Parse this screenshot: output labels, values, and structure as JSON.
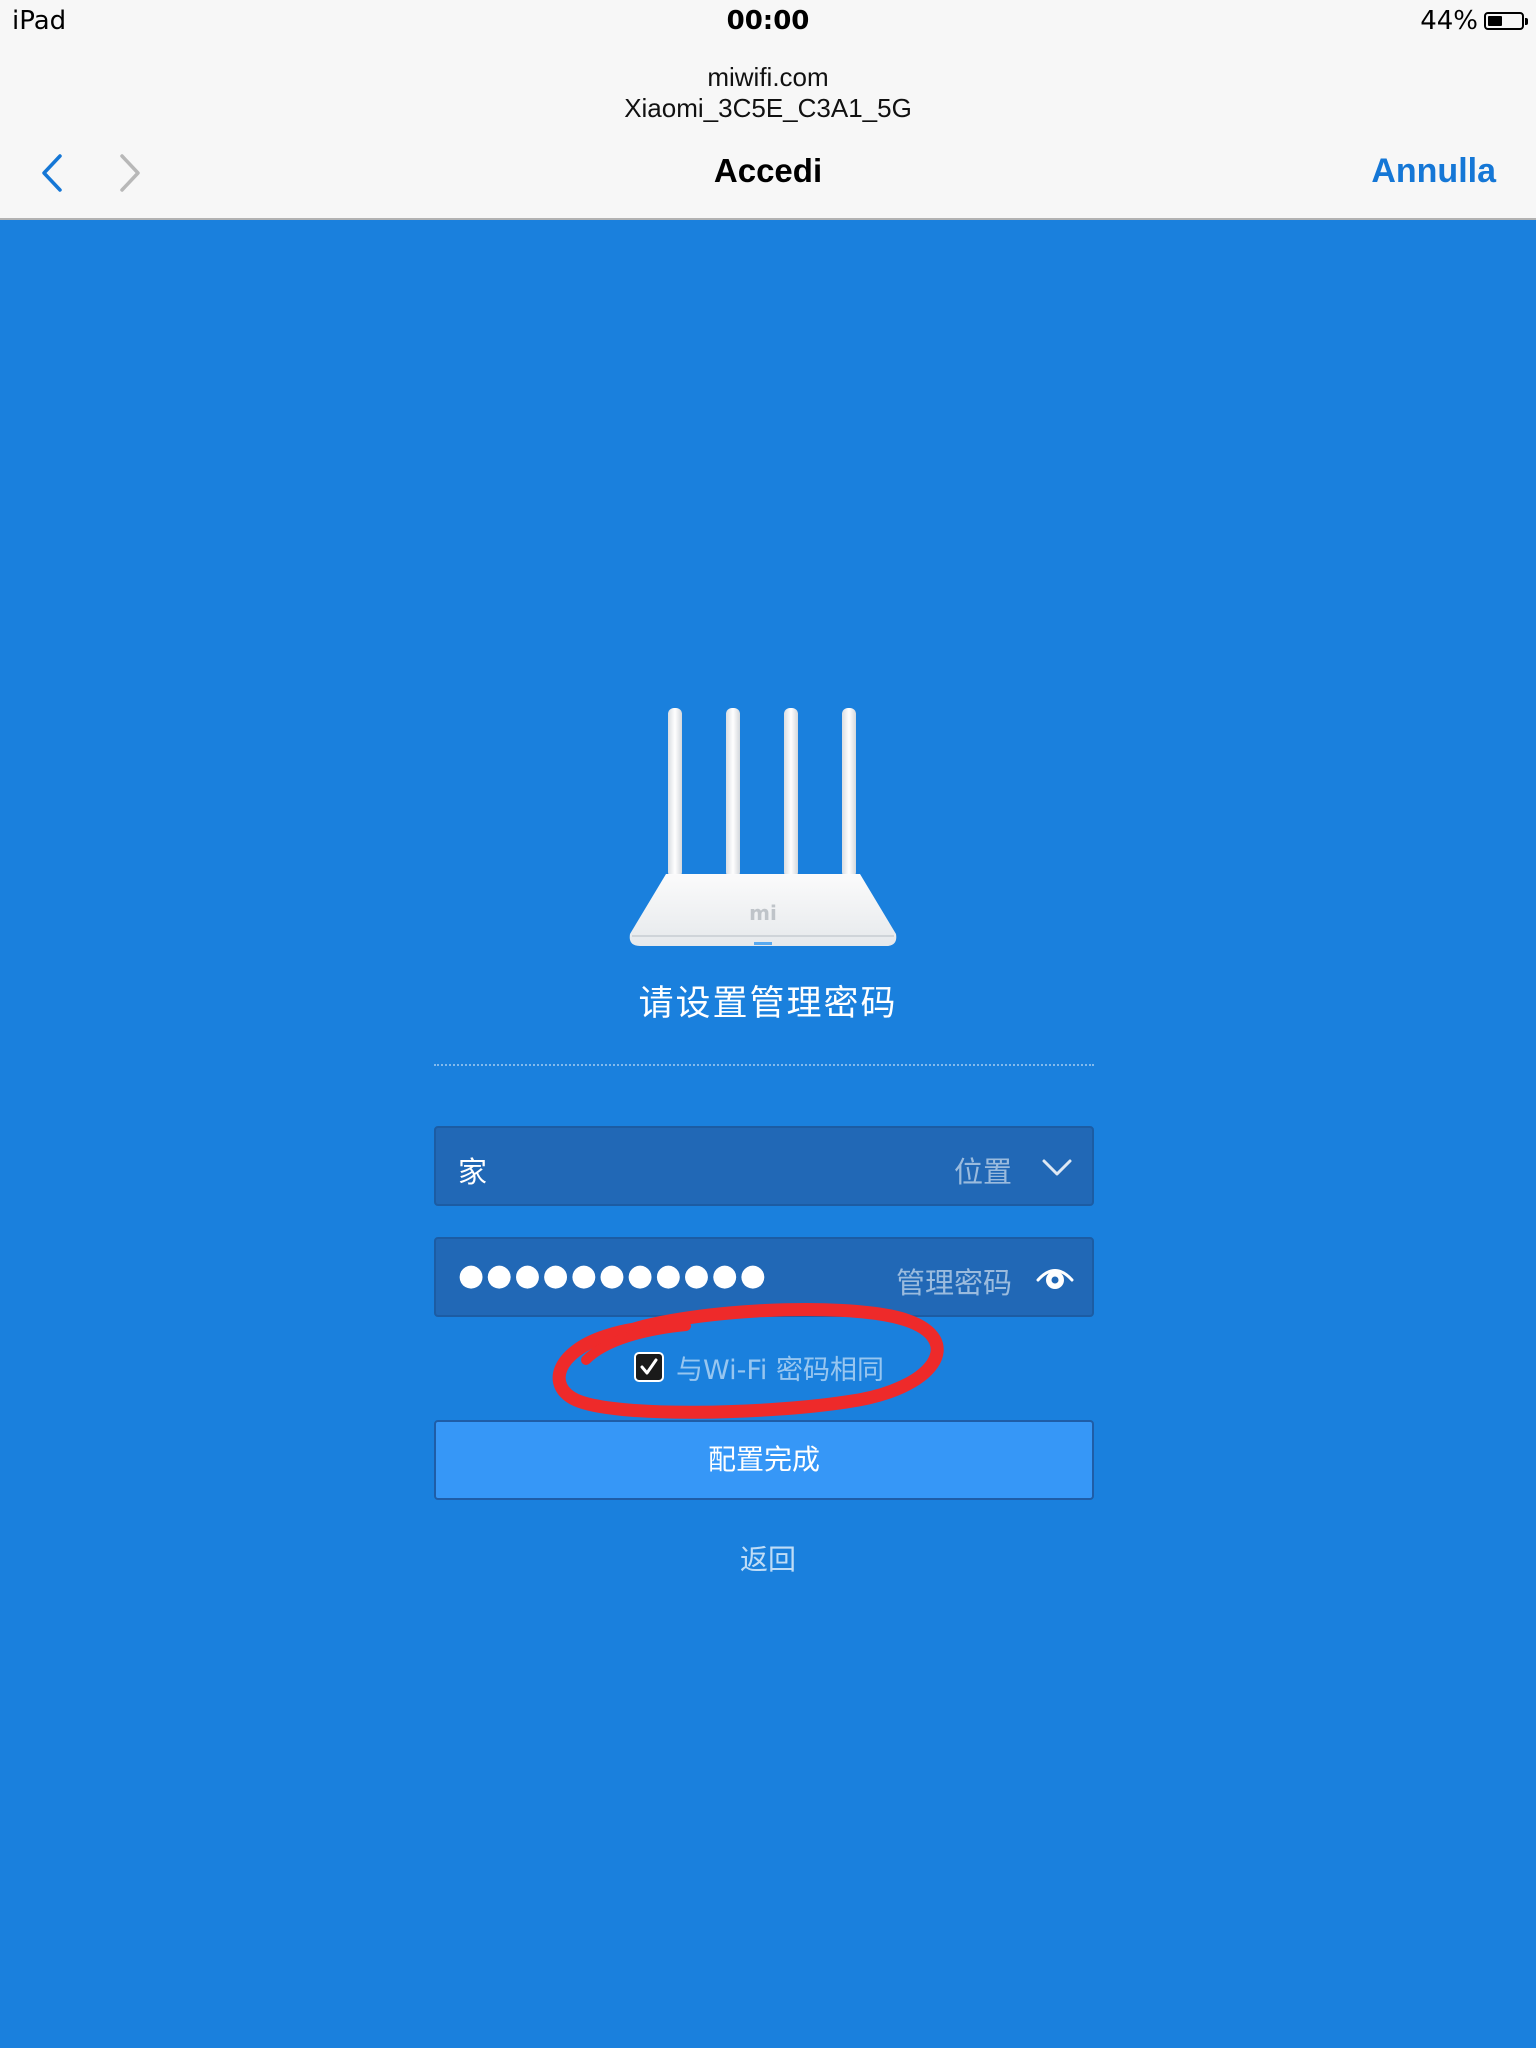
{
  "status_bar": {
    "device": "iPad",
    "time": "00:00",
    "battery": "44%",
    "battery_level": 0.44
  },
  "browser": {
    "url": "miwifi.com",
    "network": "Xiaomi_3C5E_C3A1_5G",
    "title": "Accedi",
    "cancel_label": "Annulla"
  },
  "router": {
    "logo_text": "mi"
  },
  "main": {
    "heading": "请设置管理密码",
    "location": {
      "value": "家",
      "label": "位置"
    },
    "password": {
      "value": "●●●●●●●●●●●",
      "label": "管理密码"
    },
    "same_as_wifi": {
      "label": "与Wi-Fi 密码相同",
      "checked": true
    },
    "submit_label": "配置完成",
    "back_label": "返回"
  },
  "colors": {
    "background": "#1a80dd",
    "field_bg": "#2168b6",
    "button_bg": "#3697f7",
    "accent": "#1577d6",
    "annotation": "#ee2a2a"
  }
}
